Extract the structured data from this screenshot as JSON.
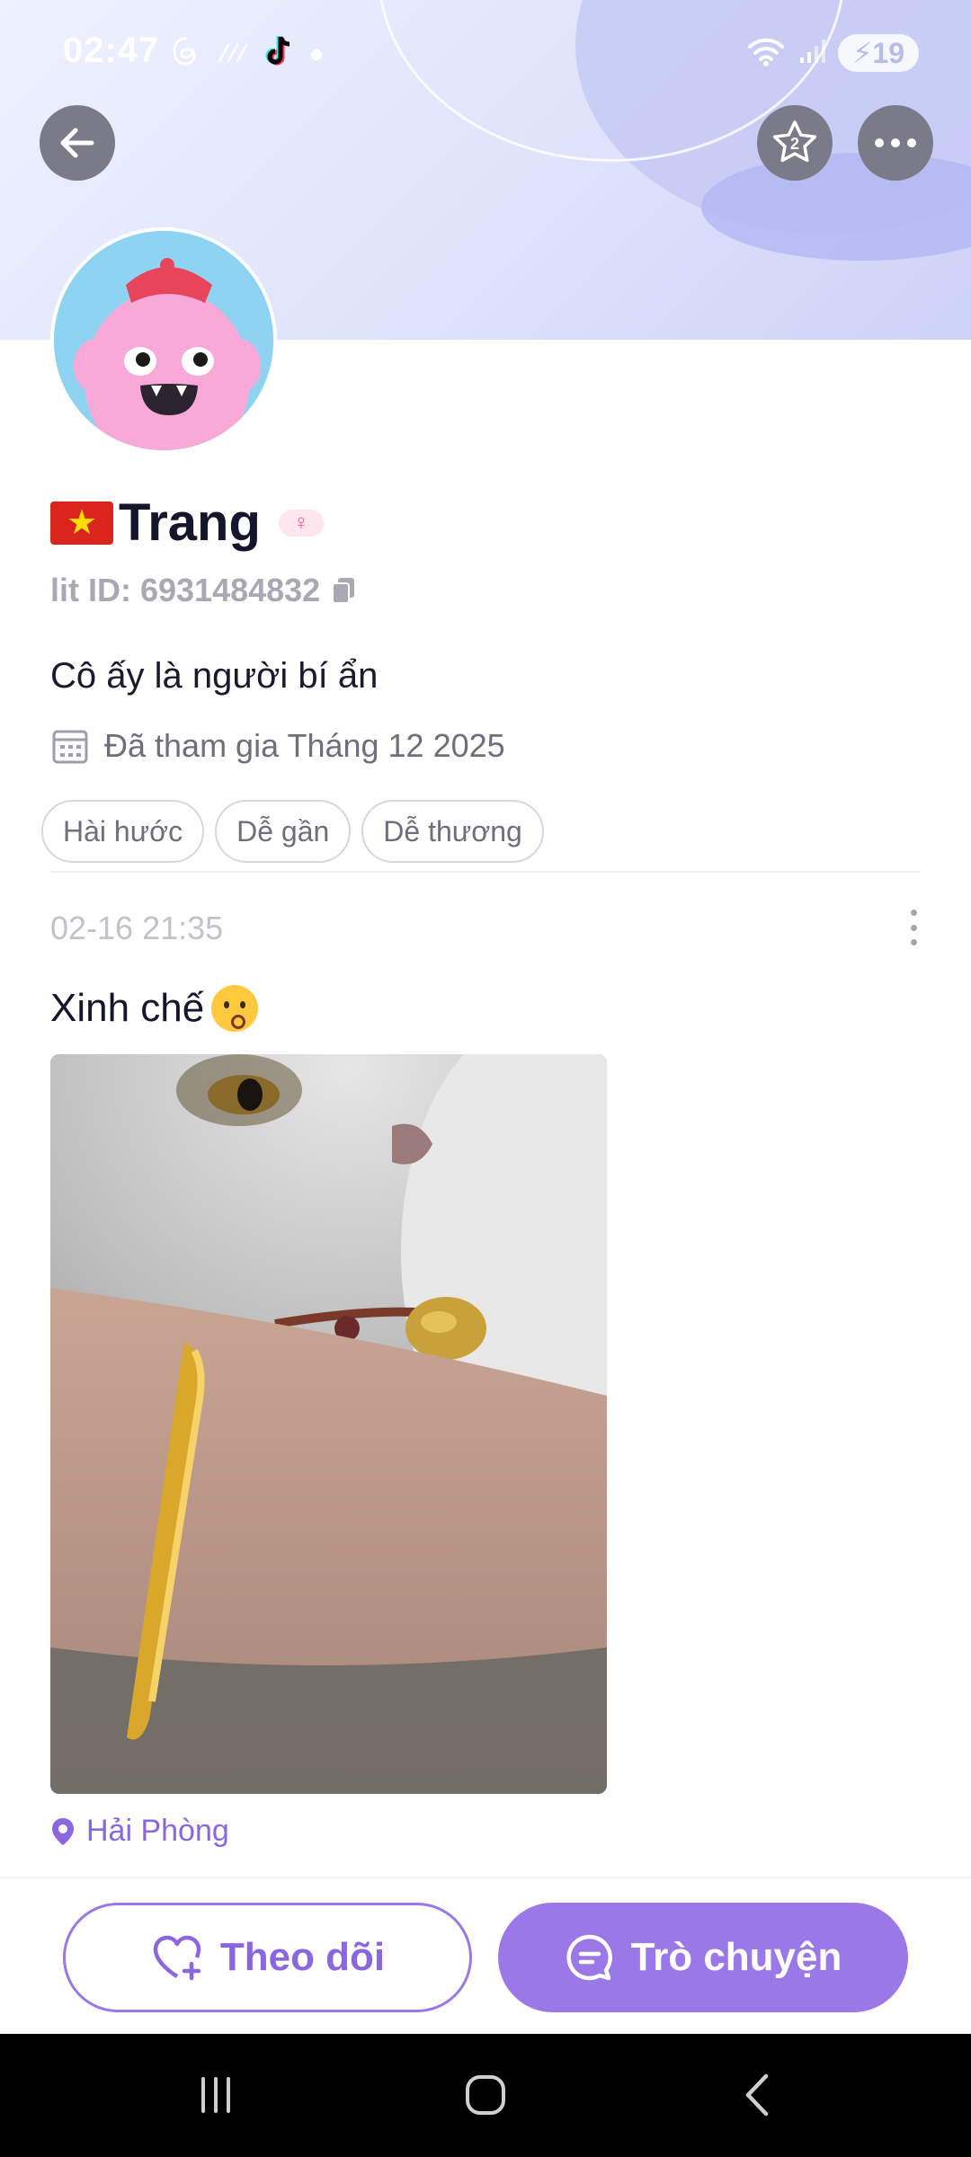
{
  "status_bar": {
    "time": "02:47",
    "battery": "19",
    "left_icons": [
      "threads-icon",
      "signal-dots-icon",
      "tiktok-icon",
      "notification-dot-icon"
    ],
    "right_icons": [
      "wifi-icon",
      "cell-signal-icon",
      "battery-icon"
    ]
  },
  "header": {
    "back_icon": "arrow-left-icon",
    "star_icon": "star-badge-icon",
    "star_badge_count": "2",
    "more_icon": "more-horizontal-icon"
  },
  "profile": {
    "flag": "vietnam-flag",
    "name": "Trang",
    "gender_icon": "female-icon",
    "lit_id": "lit ID: 6931484832",
    "bio": "Cô ấy là người bí ẩn",
    "joined": "Đã tham gia Tháng 12 2025",
    "tags": [
      "Hài hước",
      "Dễ gần",
      "Dễ thương"
    ]
  },
  "post": {
    "timestamp": "02-16 21:35",
    "text": "Xinh chế",
    "emoji": "kissing-face-emoji",
    "photo": "cat-resting-on-arm-with-gold-bracelet",
    "location": "Hải Phòng"
  },
  "actions": {
    "follow_label": "Theo dõi",
    "chat_label": "Trò chuyện"
  },
  "colors": {
    "accent": "#9a78e8",
    "accent_text": "#8a67e0",
    "banner": "#dfe3fb",
    "avatar_bg": "#8fd3f2"
  }
}
